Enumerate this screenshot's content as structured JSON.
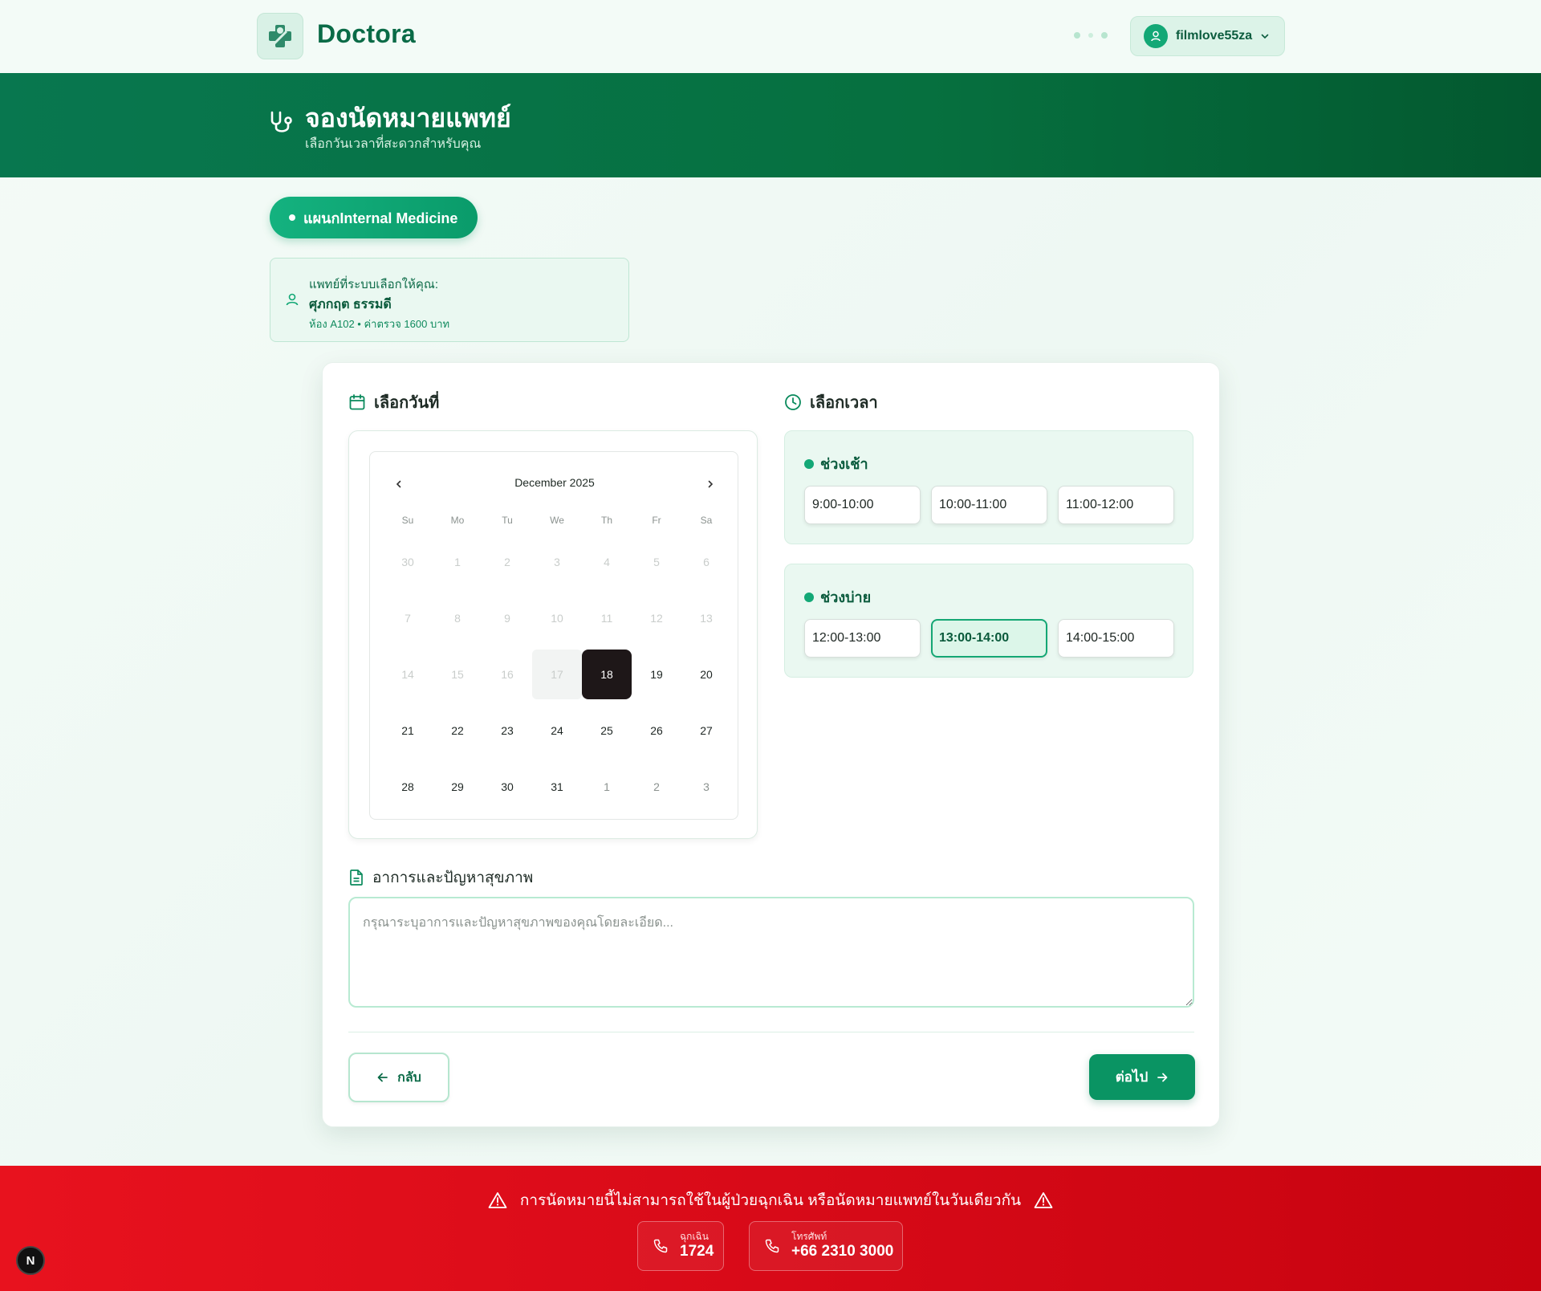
{
  "header": {
    "brand": "Doctora",
    "user": {
      "name": "filmlove55za"
    }
  },
  "hero": {
    "title": "จองนัดหมายแพทย์",
    "subtitle": "เลือกวันเวลาที่สะดวกสำหรับคุณ"
  },
  "department": {
    "label": "แผนกInternal Medicine"
  },
  "doctor": {
    "label": "แพทย์ที่ระบบเลือกให้คุณ:",
    "name": "ศุภกฤต ธรรมดี",
    "meta": "ห้อง A102 • ค่าตรวจ 1600 บาท"
  },
  "date_section": {
    "title": "เลือกวันที่",
    "month_label": "December 2025",
    "weekdays": [
      "Su",
      "Mo",
      "Tu",
      "We",
      "Th",
      "Fr",
      "Sa"
    ],
    "weeks": [
      [
        "30",
        "1",
        "2",
        "3",
        "4",
        "5",
        "6"
      ],
      [
        "7",
        "8",
        "9",
        "10",
        "11",
        "12",
        "13"
      ],
      [
        "14",
        "15",
        "16",
        "17",
        "18",
        "19",
        "20"
      ],
      [
        "21",
        "22",
        "23",
        "24",
        "25",
        "26",
        "27"
      ],
      [
        "28",
        "29",
        "30",
        "31",
        "1",
        "2",
        "3"
      ]
    ],
    "selected_day": "18"
  },
  "time_section": {
    "title": "เลือกเวลา",
    "morning": {
      "label": "ช่วงเช้า",
      "slots": [
        "9:00-10:00",
        "10:00-11:00",
        "11:00-12:00"
      ]
    },
    "afternoon": {
      "label": "ช่วงบ่าย",
      "slots": [
        "12:00-13:00",
        "13:00-14:00",
        "14:00-15:00"
      ]
    },
    "selected_slot": "13:00-14:00"
  },
  "symptoms": {
    "title": "อาการและปัญหาสุขภาพ",
    "placeholder": "กรุณาระบุอาการและปัญหาสุขภาพของคุณโดยละเอียด..."
  },
  "actions": {
    "back": "กลับ",
    "next": "ต่อไป"
  },
  "emergency": {
    "warning": "การนัดหมายนี้ไม่สามารถใช้ในผู้ป่วยฉุกเฉิน หรือนัดหมายแพทย์ในวันเดียวกัน",
    "hotline": {
      "label": "ฉุกเฉิน",
      "number": "1724"
    },
    "phone": {
      "label": "โทรศัพท์",
      "number": "+66 2310 3000"
    }
  },
  "dev_badge": "N",
  "colors": {
    "brand_green": "#0a6b47",
    "accent_green": "#13a876",
    "emergency_red": "#d80a18"
  }
}
